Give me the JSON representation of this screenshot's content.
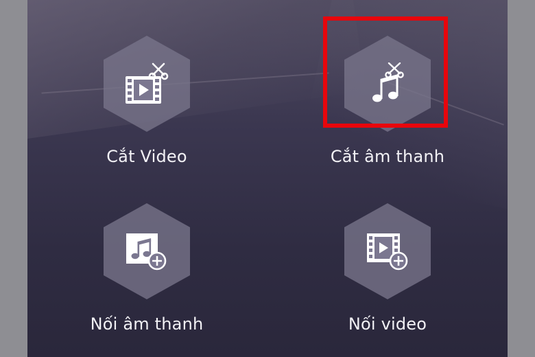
{
  "tools": [
    {
      "id": "cut-video",
      "label": "Cắt Video",
      "icon": "video-scissors-icon"
    },
    {
      "id": "cut-audio",
      "label": "Cắt âm thanh",
      "icon": "music-scissors-icon"
    },
    {
      "id": "merge-audio",
      "label": "Nối âm thanh",
      "icon": "music-add-icon"
    },
    {
      "id": "merge-video",
      "label": "Nối video",
      "icon": "video-add-icon"
    }
  ],
  "highlight": {
    "target": "cut-audio",
    "color": "#e8060c"
  }
}
